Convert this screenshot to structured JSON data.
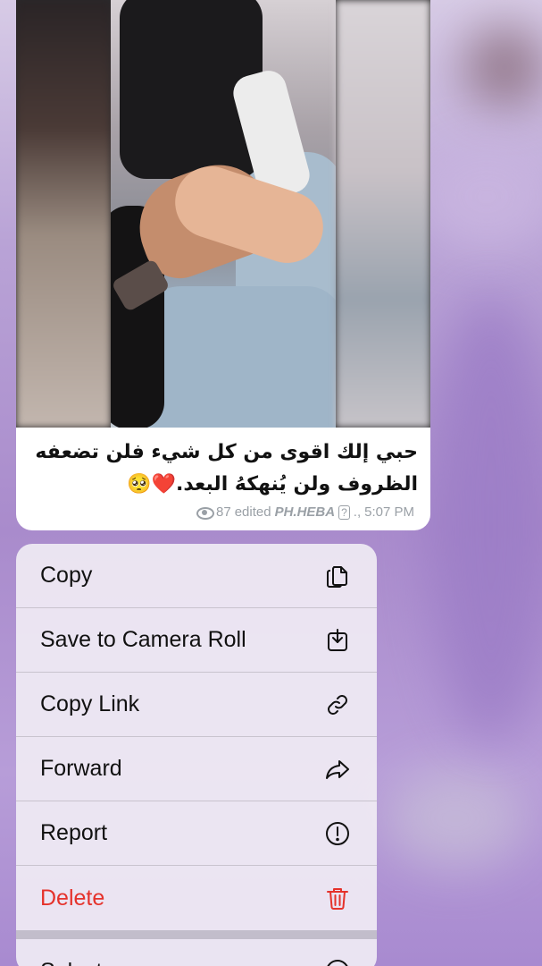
{
  "message": {
    "caption_line1": "حبي إلك اقوى من كل شيء فلن تضعفه",
    "caption_line2": "الظروف ولن يُنهكهُ البعد.",
    "caption_emoji": "❤️🥺",
    "views": "87",
    "edited_label": "edited",
    "author": "PH.HEBA",
    "author_badge": "?",
    "time": "5:07 PM"
  },
  "menu": {
    "items": [
      {
        "label": "Copy",
        "icon": "copy-icon"
      },
      {
        "label": "Save to Camera Roll",
        "icon": "download-icon"
      },
      {
        "label": "Copy Link",
        "icon": "link-icon"
      },
      {
        "label": "Forward",
        "icon": "forward-icon"
      },
      {
        "label": "Report",
        "icon": "report-icon"
      },
      {
        "label": "Delete",
        "icon": "trash-icon"
      },
      {
        "label": "Select",
        "icon": "select-icon"
      }
    ]
  },
  "colors": {
    "destructive": "#e5322b",
    "menu_background": "#f0ecf4"
  }
}
